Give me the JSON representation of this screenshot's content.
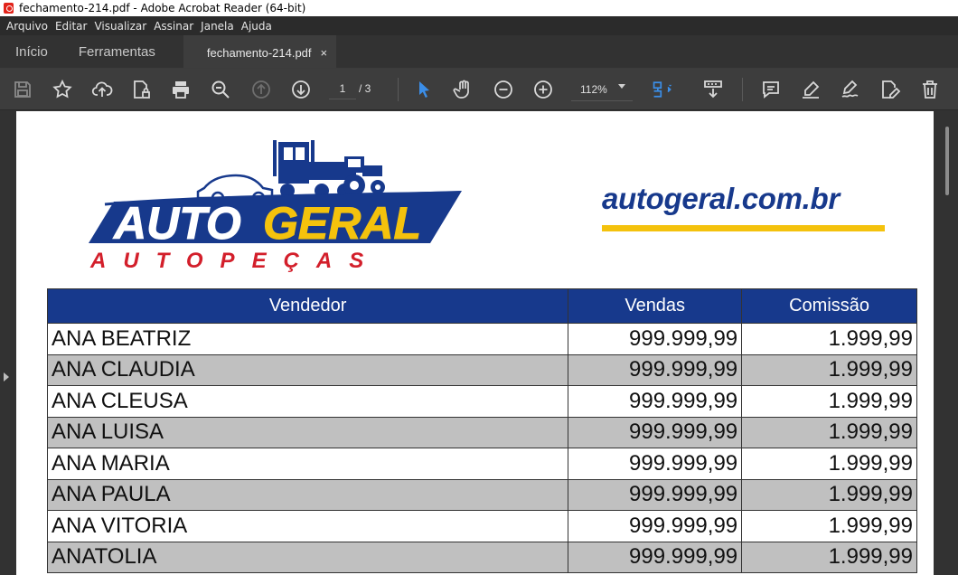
{
  "window": {
    "title": "fechamento-214.pdf - Adobe Acrobat Reader (64-bit)"
  },
  "menu": [
    "Arquivo",
    "Editar",
    "Visualizar",
    "Assinar",
    "Janela",
    "Ajuda"
  ],
  "tabs": {
    "home": "Início",
    "tools": "Ferramentas",
    "document": "fechamento-214.pdf",
    "close": "×"
  },
  "toolbar": {
    "page_current": "1",
    "page_total": "/ 3",
    "zoom": "112%",
    "icons": [
      "save-icon",
      "bookmark-star-icon",
      "upload-cloud-icon",
      "document-lock-icon",
      "print-icon",
      "zoom-search-icon",
      "page-up-icon",
      "page-down-icon",
      "select-cursor-icon",
      "hand-icon",
      "zoom-out-icon",
      "zoom-in-icon",
      "fit-page-icon",
      "scroll-mode-icon",
      "comment-icon",
      "highlight-pen-icon",
      "sign-icon",
      "edit-pdf-icon",
      "delete-icon"
    ],
    "accent_color": "#3b8ee8"
  },
  "document": {
    "logo": {
      "line1a": "AUTO",
      "line1b": "GERAL",
      "line2": "AUTOPEÇAS",
      "colors": {
        "navy": "#17398c",
        "yellow": "#f4c20d",
        "red": "#d31f2b"
      }
    },
    "site": "autogeral.com.br",
    "table": {
      "headers": [
        "Vendedor",
        "Vendas",
        "Comissão"
      ],
      "rows": [
        [
          "ANA BEATRIZ",
          "999.999,99",
          "1.999,99"
        ],
        [
          "ANA CLAUDIA",
          "999.999,99",
          "1.999,99"
        ],
        [
          "ANA CLEUSA",
          "999.999,99",
          "1.999,99"
        ],
        [
          "ANA LUISA",
          "999.999,99",
          "1.999,99"
        ],
        [
          "ANA MARIA",
          "999.999,99",
          "1.999,99"
        ],
        [
          "ANA PAULA",
          "999.999,99",
          "1.999,99"
        ],
        [
          "ANA VITORIA",
          "999.999,99",
          "1.999,99"
        ],
        [
          "ANATOLIA",
          "999.999,99",
          "1.999,99"
        ]
      ]
    }
  }
}
